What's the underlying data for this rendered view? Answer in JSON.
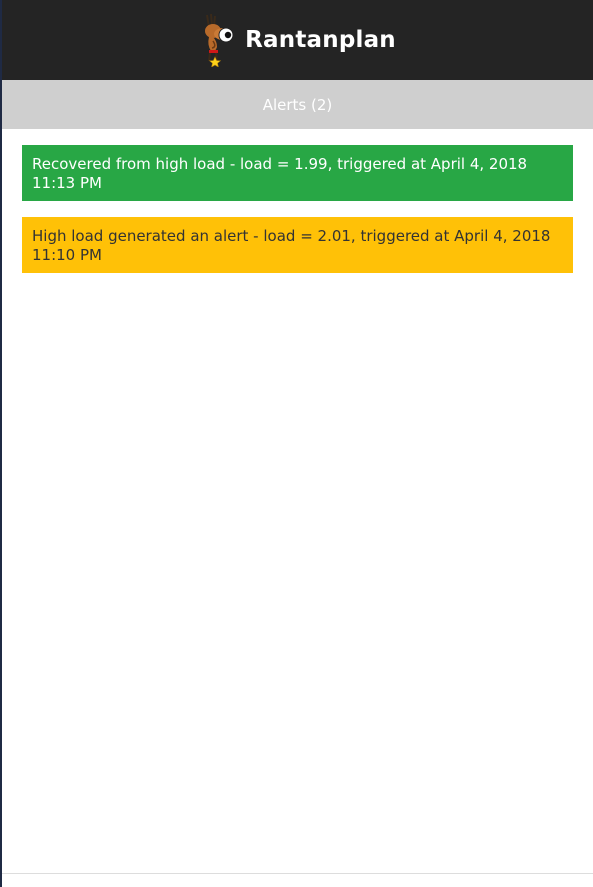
{
  "header": {
    "app_title": "Rantanplan",
    "logo_icon": "dog-mascot-icon"
  },
  "tabs": [
    {
      "label": "Alerts (2)"
    }
  ],
  "alerts": [
    {
      "type": "success",
      "text": "Recovered from high load - load = 1.99, triggered at April 4, 2018 11:13 PM"
    },
    {
      "type": "warning",
      "text": "High load generated an alert - load = 2.01, triggered at April 4, 2018 11:10 PM"
    }
  ],
  "colors": {
    "header_bg": "#242424",
    "tabbar_bg": "#cfcfcf",
    "success": "#28a745",
    "warning": "#ffc107"
  }
}
